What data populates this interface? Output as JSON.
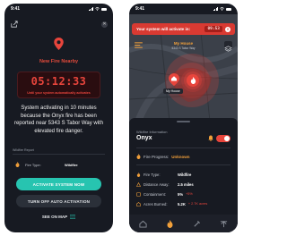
{
  "status_time": "9:41",
  "left": {
    "alert_title": "New Fire Nearby",
    "countdown": "05:12:33",
    "countdown_caption": "Until your system automatically activates",
    "message": "System activating in 10 minutes because the Onyx fire has been reported near 5343 S Tabor Way with elevated fire danger.",
    "report_label": "Wildfire Report",
    "report_rows": [
      {
        "label": "Fire Type:",
        "value": "Wildfire"
      }
    ],
    "activate_button": "ACTIVATE SYSTEM NOW",
    "turnoff_button": "TURN OFF AUTO ACTIVATION",
    "see_map": "SEE ON MAP"
  },
  "right": {
    "banner": "Your system will activate in:",
    "banner_timer": "09:53",
    "house_title": "My House",
    "house_address": "5343 S Tabor Way",
    "house_badge": "My House",
    "wildfire_label": "Wildfire Information",
    "fire_name": "Onyx",
    "fire_progress_label": "Fire Progress:",
    "fire_progress_value": "Unknown",
    "stats": [
      {
        "label": "Fire Type:",
        "value": "Wildfire",
        "delta": ""
      },
      {
        "label": "Distance Away:",
        "value": "2.5 miles",
        "delta": ""
      },
      {
        "label": "Containment:",
        "value": "5%",
        "delta": "+5%"
      },
      {
        "label": "Acres Burned:",
        "value": "5.2K",
        "delta": "+ 2.7K acres"
      }
    ]
  },
  "colors": {
    "accent_red": "#e8453c",
    "accent_teal": "#27c4b0",
    "accent_orange": "#f2a03a",
    "background": "#171a22"
  }
}
